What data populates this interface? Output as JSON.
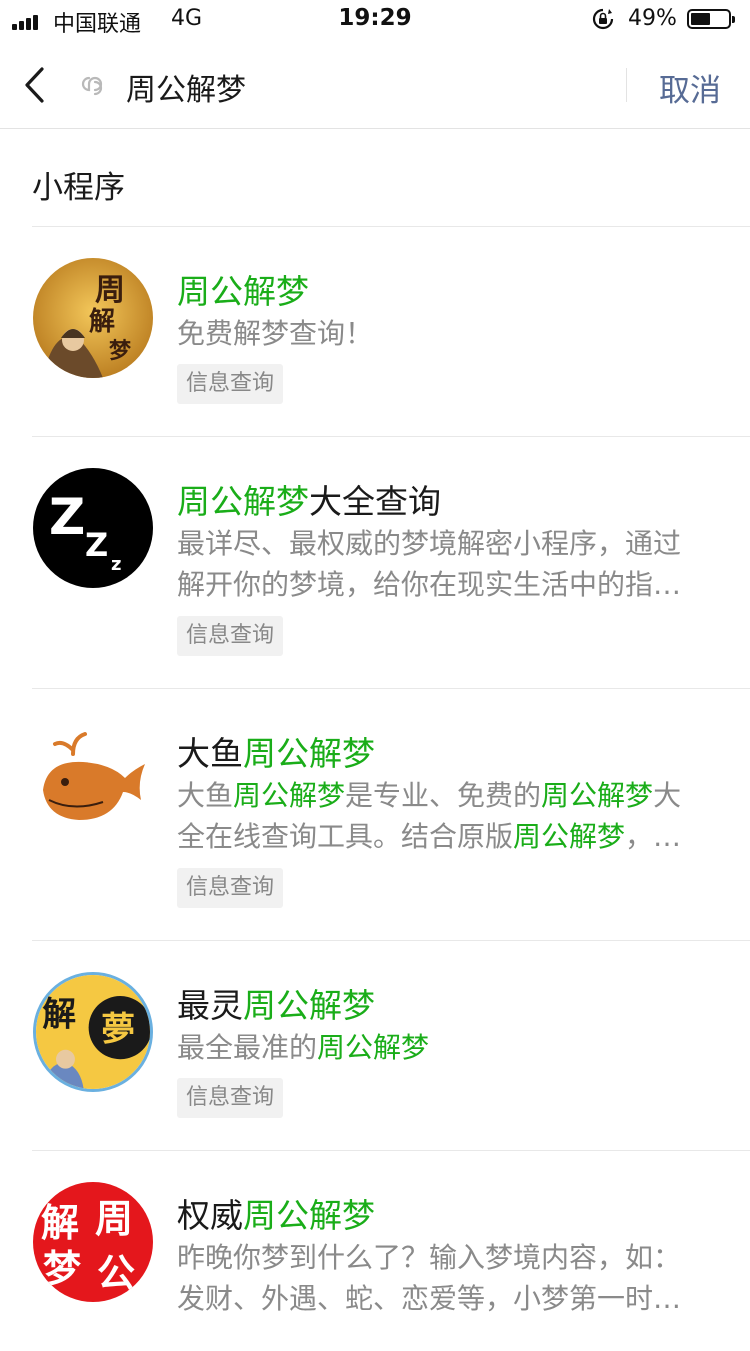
{
  "status_bar": {
    "carrier": "中国联通",
    "network": "4G",
    "time": "19:29",
    "battery": "49%",
    "battery_level": 0.49
  },
  "nav": {
    "query": "周公解梦",
    "cancel": "取消"
  },
  "section": {
    "title": "小程序"
  },
  "results": [
    {
      "name_pre": "",
      "name_hl": "周公解梦",
      "name_post": "",
      "desc1_a": "免费解梦查询！",
      "tag": "信息查询",
      "avatar": "zhougong-portrait-logo"
    },
    {
      "name_pre": "",
      "name_hl": "周公解梦",
      "name_post": "大全查询",
      "desc1_a": "最详尽、最权威的梦境解密小程序，通过",
      "desc2_a": "解开你的梦境，给你在现实生活中的指…",
      "tag": "信息查询",
      "avatar": "zzz-sleep-logo"
    },
    {
      "name_pre": "大鱼",
      "name_hl": "周公解梦",
      "name_post": "",
      "desc1_a": "大鱼",
      "desc1_h1": "周公解梦",
      "desc1_b": "是专业、免费的",
      "desc1_h2": "周公解梦",
      "desc1_c": "大",
      "desc2_a": "全在线查询工具。结合原版",
      "desc2_h1": "周公解梦",
      "desc2_b": "，…",
      "tag": "信息查询",
      "avatar": "whale-logo"
    },
    {
      "name_pre": "最灵",
      "name_hl": "周公解梦",
      "name_post": "",
      "desc1_a": "最全最准的",
      "desc1_h1": "周公解梦",
      "tag": "信息查询",
      "avatar": "jie-meng-logo",
      "avatar_chars": [
        "解",
        "夢"
      ]
    },
    {
      "name_pre": "权威",
      "name_hl": "周公解梦",
      "name_post": "",
      "desc1_a": "昨晚你梦到什么了？输入梦境内容，如：",
      "desc2_a": "发财、外遇、蛇、恋爱等，小梦第一时…",
      "avatar": "red-seal-logo",
      "avatar_chars": [
        "解",
        "周",
        "梦",
        "公"
      ]
    }
  ],
  "colors": {
    "highlight": "#1aad19",
    "link": "#576b95",
    "secondary_text": "#8a8a8a"
  }
}
